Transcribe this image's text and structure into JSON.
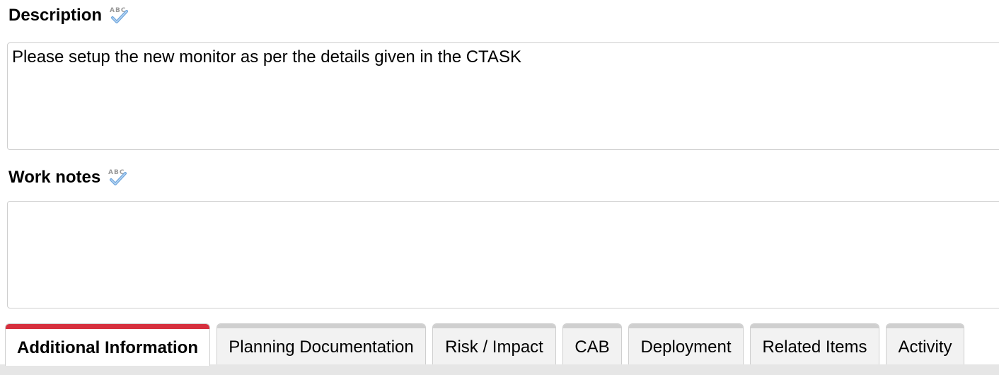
{
  "description": {
    "label": "Description",
    "value": "Please setup the new monitor as per the details given in the CTASK"
  },
  "work_notes": {
    "label": "Work notes",
    "value": ""
  },
  "tabs": [
    {
      "label": "Additional Information",
      "active": true
    },
    {
      "label": "Planning Documentation",
      "active": false
    },
    {
      "label": "Risk / Impact",
      "active": false
    },
    {
      "label": "CAB",
      "active": false
    },
    {
      "label": "Deployment",
      "active": false
    },
    {
      "label": "Related Items",
      "active": false
    },
    {
      "label": "Activity",
      "active": false
    }
  ],
  "icons": {
    "spellcheck": "spellcheck-icon"
  },
  "colors": {
    "active_tab_accent": "#d6303e",
    "tab_background": "#f2f2f2",
    "border": "#cfcfcf"
  }
}
